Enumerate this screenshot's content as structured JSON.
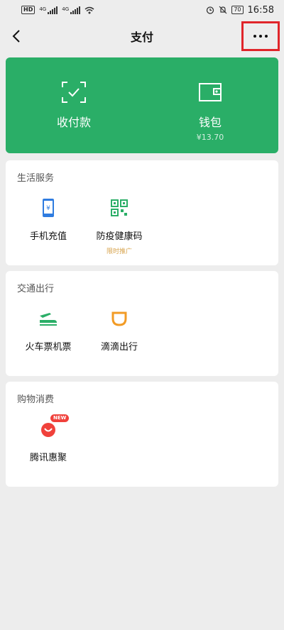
{
  "status_bar": {
    "left_badge": "HD",
    "signal1_tag": "4G",
    "signal2_tag": "4G",
    "battery": "70",
    "time": "16:58"
  },
  "nav": {
    "title": "支付"
  },
  "pay_card": {
    "items": [
      {
        "label": "收付款",
        "icon": "scan-check-icon"
      },
      {
        "label": "钱包",
        "sub": "¥13.70",
        "icon": "wallet-icon"
      }
    ]
  },
  "sections": [
    {
      "title": "生活服务",
      "items": [
        {
          "label": "手机充值",
          "icon": "phone-recharge-icon"
        },
        {
          "label": "防疫健康码",
          "sub": "限时推广",
          "icon": "qr-code-icon"
        }
      ]
    },
    {
      "title": "交通出行",
      "items": [
        {
          "label": "火车票机票",
          "icon": "train-plane-icon"
        },
        {
          "label": "滴滴出行",
          "icon": "didi-icon"
        }
      ]
    },
    {
      "title": "购物消费",
      "items": [
        {
          "label": "腾讯惠聚",
          "badge": "NEW",
          "icon": "tencent-huiju-icon"
        }
      ]
    }
  ],
  "colors": {
    "accent_green": "#2aae67",
    "highlight_red": "#e0252a",
    "promo_orange": "#d7a34c"
  }
}
